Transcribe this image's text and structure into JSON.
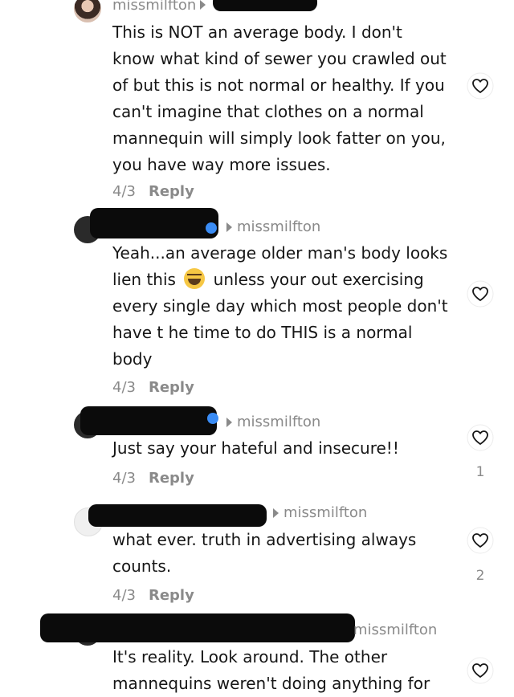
{
  "comments": [
    {
      "author": "missmilfton",
      "reply_to": "",
      "text": "This is NOT an average body. I don't know what kind of sewer you crawled out of but this is not normal or healthy. If you can't imagine that clothes on a normal mannequin will simply look fatter on you, you have way more issues.",
      "date": "4/3",
      "reply_label": "Reply",
      "likes": ""
    },
    {
      "author": "",
      "reply_to": "missmilfton",
      "text_before_emoji": "Yeah...an average older man's body looks lien this",
      "emoji": "laughing-tears",
      "text_after_emoji": "unless your out exercising every single day which most people don't have t he time to do THIS is a normal body",
      "date": "4/3",
      "reply_label": "Reply",
      "likes": ""
    },
    {
      "author": "",
      "reply_to": "missmilfton",
      "text": "Just say your hateful and insecure!!",
      "date": "4/3",
      "reply_label": "Reply",
      "likes": "1"
    },
    {
      "author": "",
      "reply_to": "missmilfton",
      "text": "what ever. truth in advertising always counts.",
      "date": "4/3",
      "reply_label": "Reply",
      "likes": "2"
    },
    {
      "author": "",
      "reply_to": "missmilfton",
      "text": "It's reality. Look around. The other mannequins weren't doing anything for",
      "date": "",
      "reply_label": "",
      "likes": ""
    }
  ],
  "colors": {
    "text": "#161616",
    "muted": "#8a8a8a",
    "redaction": "#0b0b0b",
    "verified": "#3a8cf5"
  },
  "icons": {
    "like": "heart-outline-icon",
    "reply_arrow": "caret-right-icon"
  }
}
